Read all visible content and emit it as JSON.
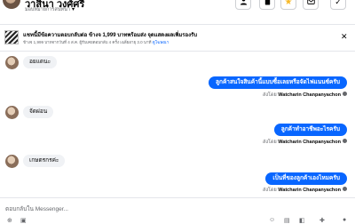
{
  "header": {
    "contact_name": "วาสินา วงศ์ศรี",
    "subtitle": "มอบหมายการสนทนา"
  },
  "banner": {
    "title": "แชทนี้มีข้อความตอบกลับต่อ ข้างจ 1,999 บาทพร้อมส่ง จุดแสดงผลเพิ่มรองรับ",
    "description": "ข้างจ 1,999 บาทจากวันที่ 4 ส.ค. ผู้รับเคยตอบกลับ 4 ครั้ง เฉลี่ยอายุ 3.0 นาที",
    "link": "ดูโฆษณา"
  },
  "messages": {
    "m1": {
      "text": "อยแดนะ"
    },
    "m2": {
      "text": "ลูกค้าสนใจสินค้านี้แบบซื้อเลยหรือจัดไฟแนนซ์ครับ",
      "sent_by_prefix": "ส่งโดย",
      "sent_by": "Watcharin Chanpanyachon"
    },
    "m3": {
      "text": "จัดผ่อน"
    },
    "m4": {
      "text": "ลูกค้าทำอาชีพอะไรครับ",
      "sent_by_prefix": "ส่งโดย",
      "sent_by": "Watcharin Chanpanyachon"
    },
    "m5": {
      "text": "เกษตรกรค่ะ"
    },
    "m6": {
      "text": "เป็นที่ของลูกค้าเองไหมครับ",
      "sent_by_prefix": "ส่งโดย",
      "sent_by": "Watcharin Chanpanyachon"
    }
  },
  "composer": {
    "placeholder": "ตอบกลับใน Messenger..."
  },
  "icons": {
    "header": [
      "person-icon",
      "trash-icon",
      "star-icon",
      "envelope-icon",
      "check-icon"
    ],
    "banner": [
      "close-icon"
    ],
    "composer": [
      "attach-icon",
      "photo-icon",
      "emoji-icon",
      "gif-icon",
      "sticker-icon",
      "like-icon"
    ]
  },
  "colors": {
    "accent": "#0866ff",
    "star": "#f7b928",
    "incoming_bubble": "#f0f2f5",
    "secondary_text": "#65676b"
  }
}
